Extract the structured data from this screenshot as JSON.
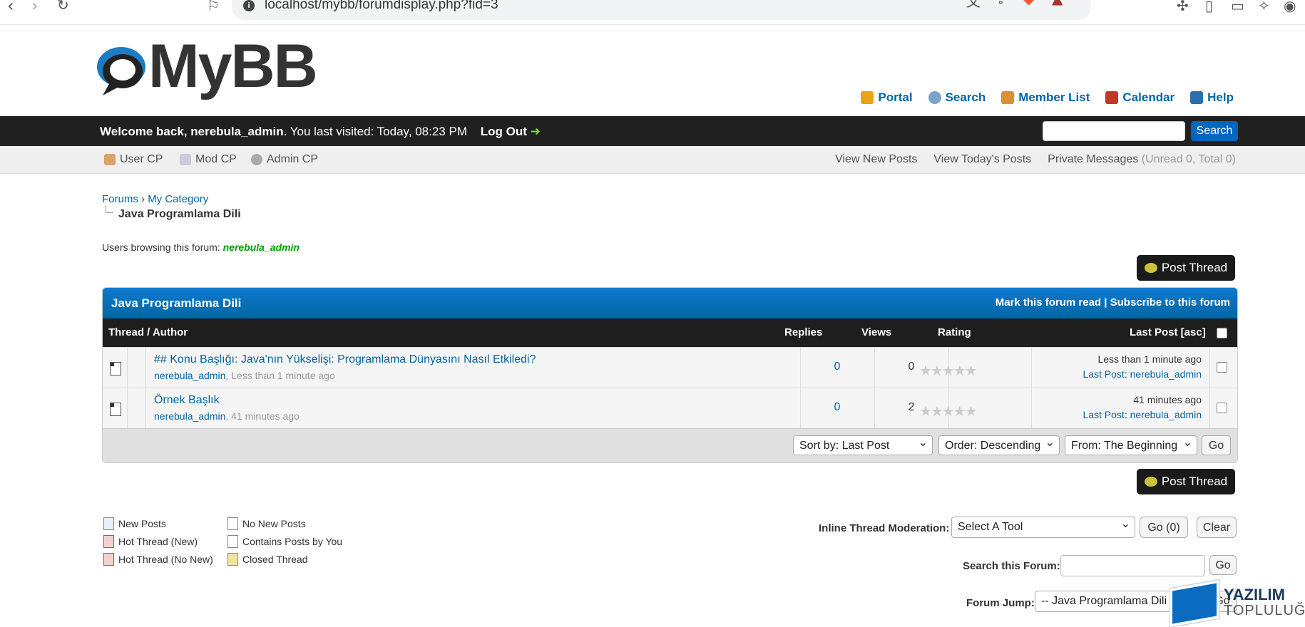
{
  "browser": {
    "url": "localhost/mybb/forumdisplay.php?fid=3",
    "info_glyph": "i"
  },
  "logo": {
    "text": "MyBB"
  },
  "toplinks": [
    {
      "label": "Portal",
      "color": "#e8a317"
    },
    {
      "label": "Search",
      "color": "#7aa4c9"
    },
    {
      "label": "Member List",
      "color": "#d99030"
    },
    {
      "label": "Calendar",
      "color": "#c0392b"
    },
    {
      "label": "Help",
      "color": "#2c6fb0"
    }
  ],
  "welcome": {
    "prefix": "Welcome back, ",
    "user": "nerebula_admin",
    "visited": ". You last visited: Today, 08:23 PM",
    "logout": "Log Out",
    "search_button": "Search"
  },
  "panel": {
    "user_cp": "User CP",
    "mod_cp": "Mod CP",
    "admin_cp": "Admin CP",
    "view_new": "View New Posts",
    "view_today": "View Today's Posts",
    "pm": "Private Messages",
    "pm_counts": "(Unread 0, Total 0)"
  },
  "breadcrumb": {
    "forums": "Forums",
    "sep": "›",
    "category": "My Category",
    "current": "Java Programlama Dili"
  },
  "browsing": {
    "label": "Users browsing this forum: ",
    "user": "nerebula_admin"
  },
  "post_thread_label": "Post Thread",
  "table": {
    "title": "Java Programlama Dili",
    "mark_read": "Mark this forum read",
    "divider": "|",
    "subscribe": "Subscribe to this forum",
    "col_thread": "Thread / Author",
    "col_replies": "Replies",
    "col_views": "Views",
    "col_rating": "Rating",
    "col_lastpost": "Last Post [asc]",
    "rows": [
      {
        "subject": "## Konu Başlığı: Java'nın Yükselişi: Programlama Dünyasını Nasıl Etkiledi?",
        "author": "nerebula_admin",
        "time": ", Less than 1 minute ago",
        "replies": "0",
        "views": "0",
        "rating": "★★★★★",
        "lp_time": "Less than 1 minute ago",
        "lp_label": "Last Post",
        "lp_user": "nerebula_admin"
      },
      {
        "subject": "Örnek Başlık",
        "author": "nerebula_admin",
        "time": ", 41 minutes ago",
        "replies": "0",
        "views": "2",
        "rating": "★★★★★",
        "lp_time": "41 minutes ago",
        "lp_label": "Last Post",
        "lp_user": "nerebula_admin"
      }
    ],
    "sort_by": "Sort by: Last Post",
    "order": "Order: Descending",
    "from": "From: The Beginning",
    "go": "Go"
  },
  "legend": {
    "new_posts": "New Posts",
    "no_new_posts": "No New Posts",
    "hot_new": "Hot Thread (New)",
    "contains_yours": "Contains Posts by You",
    "hot_no_new": "Hot Thread (No New)",
    "closed": "Closed Thread"
  },
  "moderation": {
    "label": "Inline Thread Moderation:",
    "tool": "Select A Tool",
    "go": "Go (0)",
    "clear": "Clear",
    "search_label": "Search this Forum:",
    "search_go": "Go",
    "jump_label": "Forum Jump:",
    "jump_value": "-- Java Programlama Dili",
    "jump_go": "Go"
  },
  "watermark": {
    "line1": "YAZILIM",
    "line2": "TOPLULUĞU"
  }
}
